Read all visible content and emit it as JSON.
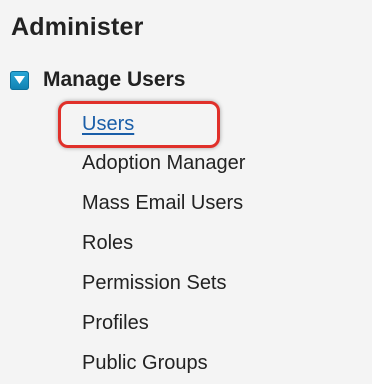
{
  "section": {
    "title": "Administer"
  },
  "group": {
    "label": "Manage Users",
    "toggle_icon": "collapse-triangle-icon",
    "accent_color": "#1a8fc4",
    "items": [
      {
        "label": "Users",
        "is_link": true
      },
      {
        "label": "Adoption Manager",
        "is_link": false
      },
      {
        "label": "Mass Email Users",
        "is_link": false
      },
      {
        "label": "Roles",
        "is_link": false
      },
      {
        "label": "Permission Sets",
        "is_link": false
      },
      {
        "label": "Profiles",
        "is_link": false
      },
      {
        "label": "Public Groups",
        "is_link": false
      }
    ]
  },
  "highlight_color": "#e0302a"
}
